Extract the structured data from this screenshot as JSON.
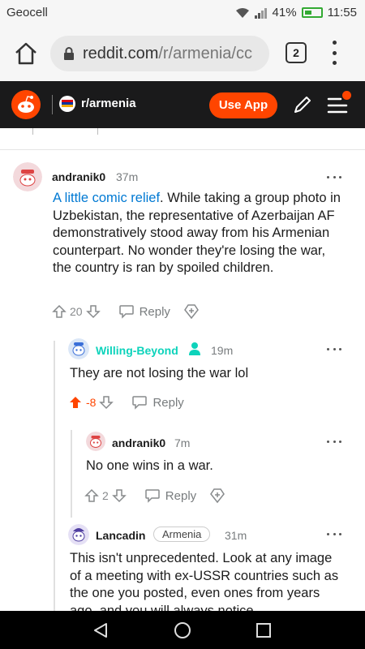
{
  "status_bar": {
    "carrier": "Geocell",
    "battery": "41%",
    "time": "11:55"
  },
  "browser": {
    "url_host": "reddit.com",
    "url_path": "/r/armenia/cc",
    "tab_count": "2"
  },
  "reddit_header": {
    "subreddit": "r/armenia",
    "use_app_label": "Use App"
  },
  "comments": [
    {
      "username": "andranik0",
      "time": "37m",
      "link_text": "A little comic relief",
      "body": ". While taking a group photo in Uzbekistan, the representative of Azerbaijan AF demonstratively stood away from his Armenian counterpart. No wonder they're losing the war, the country is ran by spoiled children.",
      "votes": "20",
      "reply_label": "Reply"
    },
    {
      "username": "Willing-Beyond",
      "time": "19m",
      "body": "They are not losing the war lol",
      "votes": "-8",
      "reply_label": "Reply"
    },
    {
      "username": "andranik0",
      "time": "7m",
      "body": "No one wins in a war.",
      "votes": "2",
      "reply_label": "Reply"
    },
    {
      "username": "Lancadin",
      "flair": "Armenia",
      "time": "31m",
      "body": "This isn't unprecedented. Look at any image of a meeting with ex-USSR countries such as the one you posted, even ones from years ago, and you will always notice"
    }
  ],
  "colors": {
    "accent": "#ff4500",
    "link": "#0079d3",
    "header_bg": "#1a1a1b",
    "willing_beyond_name": "#0dd3bb"
  }
}
